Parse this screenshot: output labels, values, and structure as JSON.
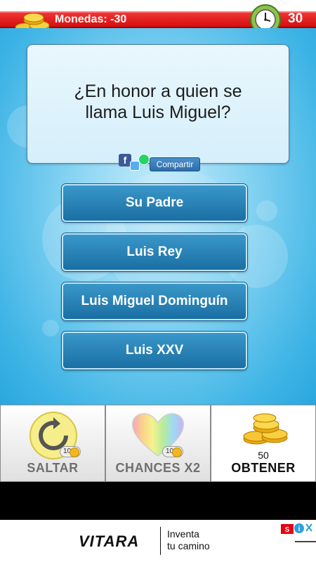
{
  "header": {
    "coins_label": "Monedas: -30",
    "timer": "30"
  },
  "question": {
    "text": "¿En honor a quien se llama Luis Miguel?",
    "share_label": "Compartir"
  },
  "answers": [
    {
      "label": "Su Padre"
    },
    {
      "label": "Luis Rey"
    },
    {
      "label": "Luis Miguel Dominguín"
    },
    {
      "label": "Luis XXV"
    }
  ],
  "powerups": [
    {
      "label": "SALTAR",
      "cost": "10",
      "icon": "refresh-icon"
    },
    {
      "label": "CHANCES X2",
      "cost": "10",
      "icon": "rainbow-heart-icon"
    },
    {
      "label": "OBTENER",
      "amount": "50",
      "icon": "coins-icon"
    }
  ],
  "ad": {
    "brand": "VITARA",
    "slogan_line1": "Inventa",
    "slogan_line2": "tu camino"
  },
  "colors": {
    "top_bar": "#e21b1b",
    "answer_button": "#2a86bd",
    "background": "#86d3f2"
  }
}
